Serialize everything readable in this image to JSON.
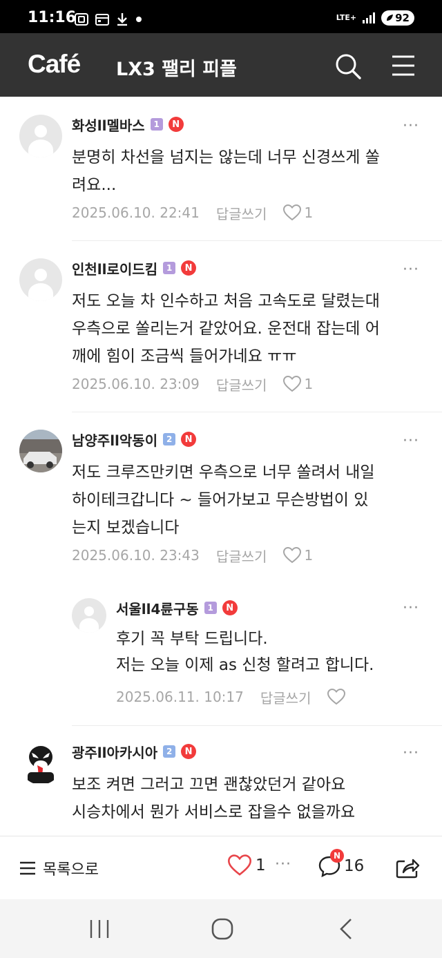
{
  "status_bar": {
    "time": "11:16",
    "network": "LTE+",
    "battery": "92"
  },
  "header": {
    "logo": "Café",
    "cafe_name": "LX3 팰리 피플"
  },
  "comments": [
    {
      "nickname": "화성ll멜바스",
      "level": "1",
      "new_badge": "N",
      "text_lines": [
        "분명히 차선을 넘지는 않는데 너무 신경쓰게 쏠",
        "려요..."
      ],
      "date": "2025.06.10. 22:41",
      "reply_label": "답글쓰기",
      "likes": "1"
    },
    {
      "nickname": "인천ll로이드킴",
      "level": "1",
      "new_badge": "N",
      "text_lines": [
        "저도 오늘 차 인수하고 처음 고속도로 달렸는대",
        "우측으로 쏠리는거 같았어요. 운전대 잡는데 어",
        "깨에 힘이 조금씩 들어가네요 ㅠㅠ"
      ],
      "date": "2025.06.10. 23:09",
      "reply_label": "답글쓰기",
      "likes": "1"
    },
    {
      "nickname": "남양주ll악동이",
      "level": "2",
      "new_badge": "N",
      "text_lines": [
        "저도 크루즈만키면 우측으로 너무 쏠려서 내일",
        "하이테크갑니다 ~ 들어가보고 무슨방법이 있",
        "는지 보겠습니다"
      ],
      "date": "2025.06.10. 23:43",
      "reply_label": "답글쓰기",
      "likes": "1"
    },
    {
      "nickname": "서울ll4륜구동",
      "level": "1",
      "new_badge": "N",
      "text_lines": [
        "후기 꼭 부탁 드립니다.",
        "저는 오늘 이제 as 신청 할려고 합니다."
      ],
      "date": "2025.06.11. 10:17",
      "reply_label": "답글쓰기",
      "likes": ""
    },
    {
      "nickname": "광주ll아카시아",
      "level": "2",
      "new_badge": "N",
      "text_lines": [
        "보조 켜면 그러고 끄면 괜찮았던거 같아요",
        "시승차에서 뭔가 서비스로 잡을수 없을까요"
      ],
      "date": "",
      "reply_label": "",
      "likes": ""
    }
  ],
  "bottom_bar": {
    "list_label": "목록으로",
    "like_count": "1",
    "comment_badge": "N",
    "comment_count": "16"
  },
  "colors": {
    "header_bg": "#333333",
    "badge_red": "#f23b3b",
    "level1": "#b49bdc",
    "level2": "#8fb0e8"
  },
  "icons": [
    "search-icon",
    "menu-icon",
    "heart-icon",
    "more-icon",
    "comment-icon",
    "share-icon",
    "list-icon"
  ]
}
